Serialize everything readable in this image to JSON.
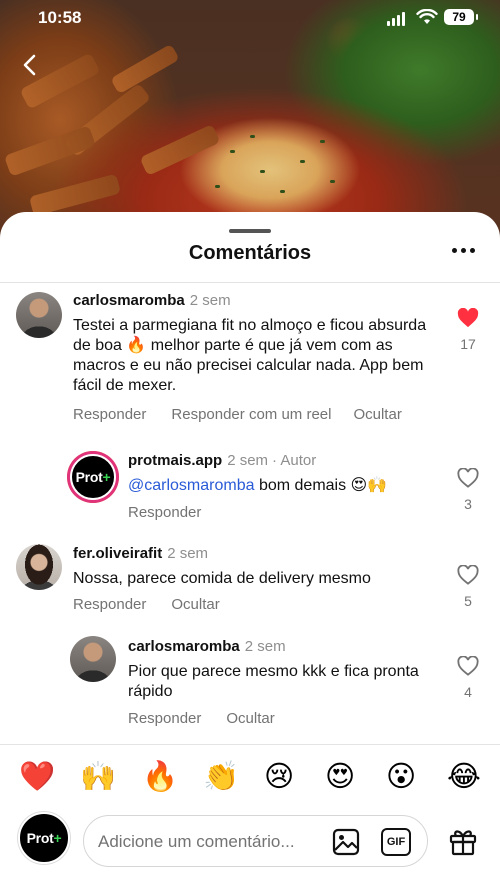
{
  "status_bar": {
    "time": "10:58",
    "battery": "79"
  },
  "sheet": {
    "title": "Comentários"
  },
  "comments": [
    {
      "username": "carlosmaromba",
      "time": "2 sem",
      "text": "Testei a parmegiana fit no almoço e ficou absurda de boa 🔥 melhor parte é que já vem com as macros e eu não precisei calcular nada. App bem fácil de mexer.",
      "likes": "17",
      "liked": true,
      "actions": [
        "Responder",
        "Responder com um reel",
        "Ocultar"
      ]
    },
    {
      "username": "protmais.app",
      "time": "2 sem",
      "badge": "· Autor",
      "mention": "@carlosmaromba",
      "text": " bom demais 😍🙌",
      "likes": "3",
      "liked": false,
      "actions": [
        "Responder"
      ]
    },
    {
      "username": "fer.oliveirafit",
      "time": "2 sem",
      "text": "Nossa, parece comida de delivery mesmo",
      "likes": "5",
      "liked": false,
      "actions": [
        "Responder",
        "Ocultar"
      ]
    },
    {
      "username": "carlosmaromba",
      "time": "2 sem",
      "text": "Pior que parece mesmo kkk e fica pronta rápido",
      "likes": "4",
      "liked": false,
      "actions": [
        "Responder",
        "Ocultar"
      ]
    }
  ],
  "brand": {
    "logo_text": "Prot",
    "logo_plus": "+"
  },
  "emoji_bar": [
    "❤️",
    "🙌",
    "🔥",
    "👏",
    "😢",
    "😍",
    "😮",
    "😂"
  ],
  "composer": {
    "placeholder": "Adicione um comentário...",
    "gif_label": "GIF"
  },
  "colors": {
    "like_red": "#ff3040",
    "mention_blue": "#2a5bd7",
    "brand_green": "#39d353"
  },
  "icons": [
    "back-icon",
    "more-icon",
    "heart-icon",
    "image-icon",
    "gif-icon",
    "gift-icon"
  ]
}
